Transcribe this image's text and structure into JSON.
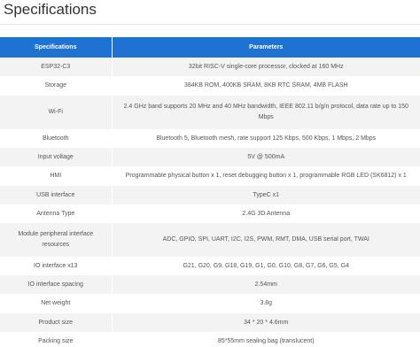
{
  "page": {
    "title": "Specifications"
  },
  "table": {
    "headers": [
      "Specifications",
      "Parameters"
    ],
    "rows": [
      {
        "spec": "ESP32-C3",
        "param": "32bit RISC-V single-core processor, clocked at 160 MHz"
      },
      {
        "spec": "Storage",
        "param": "384KB ROM, 400KB SRAM, 8KB RTC SRAM, 4MB FLASH"
      },
      {
        "spec": "Wi-Fi",
        "param": "2.4 GHz band supports 20 MHz and 40 MHz bandwidth, IEEE 802.11 b/g/n protocol, data rate up to 150 Mbps"
      },
      {
        "spec": "Bluetooth",
        "param": "Bluetooth 5, Bluetooth mesh, rate support 125 Kbps, 500 Kbps, 1 Mbps, 2 Mbps"
      },
      {
        "spec": "Input voltage",
        "param": "5V @ 500mA"
      },
      {
        "spec": "HMI",
        "param": "Programmable physical button x 1, reset debugging button x 1, programmable RGB LED (SK6812) x 1"
      },
      {
        "spec": "USB interface",
        "param": "TypeC x1"
      },
      {
        "spec": "Antenna Type",
        "param": "2.4G 3D Antenna"
      },
      {
        "spec": "Module peripheral interface resources",
        "param": "ADC, GPIO, SPI, UART, I2C, I2S, PWM, RMT, DMA, USB serial port, TWAI"
      },
      {
        "spec": "IO interface x13",
        "param": "G21, G20, G9, G18, G19, G1, G0, G10, G8, G7, G6, G5, G4"
      },
      {
        "spec": "IO interface spacing",
        "param": "2.54mm"
      },
      {
        "spec": "Net weight",
        "param": "3.8g"
      },
      {
        "spec": "Product size",
        "param": "34 * 20 * 4.6mm"
      },
      {
        "spec": "Packing size",
        "param": "85*55mm sealing bag (translucent)"
      }
    ]
  }
}
